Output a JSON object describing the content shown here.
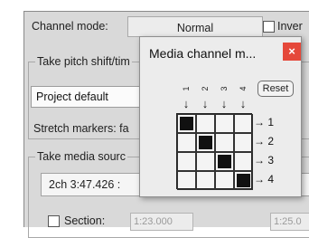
{
  "background": {
    "channel_mode_label": "Channel mode:",
    "channel_mode_value": "Normal",
    "invert_label": "Inver",
    "pitch_group_label": "Take pitch shift/tim",
    "pitch_dropdown_value": "Project default",
    "stretch_label": "Stretch markers: fa",
    "source_group_label": "Take media sourc",
    "source_value": "2ch 3:47.426 :",
    "section_label": "Section:",
    "section_value": "1:23.000",
    "fade_value": "1:25.0"
  },
  "popup": {
    "title": "Media channel m...",
    "close_label": "×",
    "reset_label": "Reset",
    "column_labels": [
      "1",
      "2",
      "3",
      "4"
    ],
    "row_labels": [
      "1",
      "2",
      "3",
      "4"
    ],
    "arrow_down": "↓",
    "arrow_right": "→",
    "matrix": [
      [
        1,
        0,
        0,
        0
      ],
      [
        0,
        1,
        0,
        0
      ],
      [
        0,
        0,
        1,
        0
      ],
      [
        0,
        0,
        0,
        1
      ]
    ]
  }
}
